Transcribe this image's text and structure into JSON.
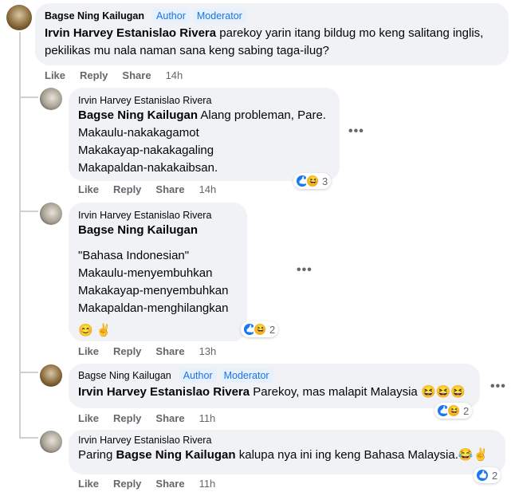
{
  "comments": [
    {
      "author": "Bagse Ning Kailugan",
      "badges": [
        "Author",
        "Moderator"
      ],
      "mention": "Irvin Harvey Estanislao Rivera",
      "text_line1": " parekoy yarin itang bildug mo keng salitang inglis,",
      "text_line2": "pekilikas mu nala naman sana keng sabing taga-ilug?",
      "actions": [
        "Like",
        "Reply",
        "Share"
      ],
      "time": "14h"
    },
    {
      "author": "Irvin Harvey Estanislao Rivera",
      "mention": "Bagse Ning Kailugan",
      "text_line1": " Alang probleman, Pare.",
      "lines": [
        "Makaulu-nakakagamot",
        "Makakayap-nakakagaling",
        "Makapaldan-nakakaibsan."
      ],
      "actions": [
        "Like",
        "Reply",
        "Share"
      ],
      "time": "14h",
      "reaction_count": "3",
      "more": "•••"
    },
    {
      "author": "Irvin Harvey Estanislao Rivera",
      "mention": "Bagse Ning Kailugan",
      "lines": [
        "\"Bahasa Indonesian\"",
        "Makaulu-menyembuhkan",
        "Makakayap-menyembuhkan",
        "Makapaldan-menghilangkan"
      ],
      "emojis": "😊 ✌️",
      "actions": [
        "Like",
        "Reply",
        "Share"
      ],
      "time": "13h",
      "reaction_count": "2",
      "more": "•••"
    },
    {
      "author": "Bagse Ning Kailugan",
      "badges": [
        "Author",
        "Moderator"
      ],
      "mention": "Irvin Harvey Estanislao Rivera",
      "text": " Parekoy, mas malapit Malaysia ",
      "emojis": "😆😆😆",
      "actions": [
        "Like",
        "Reply",
        "Share"
      ],
      "time": "11h",
      "reaction_count": "2",
      "more": "•••"
    },
    {
      "author": "Irvin Harvey Estanislao Rivera",
      "text_before": "Paring ",
      "mention": "Bagse Ning Kailugan",
      "text_after": " kalupa nya ini ing keng Bahasa Malaysia.",
      "emojis": "😂✌️",
      "actions": [
        "Like",
        "Reply",
        "Share"
      ],
      "time": "11h",
      "reaction_count": "2"
    }
  ]
}
